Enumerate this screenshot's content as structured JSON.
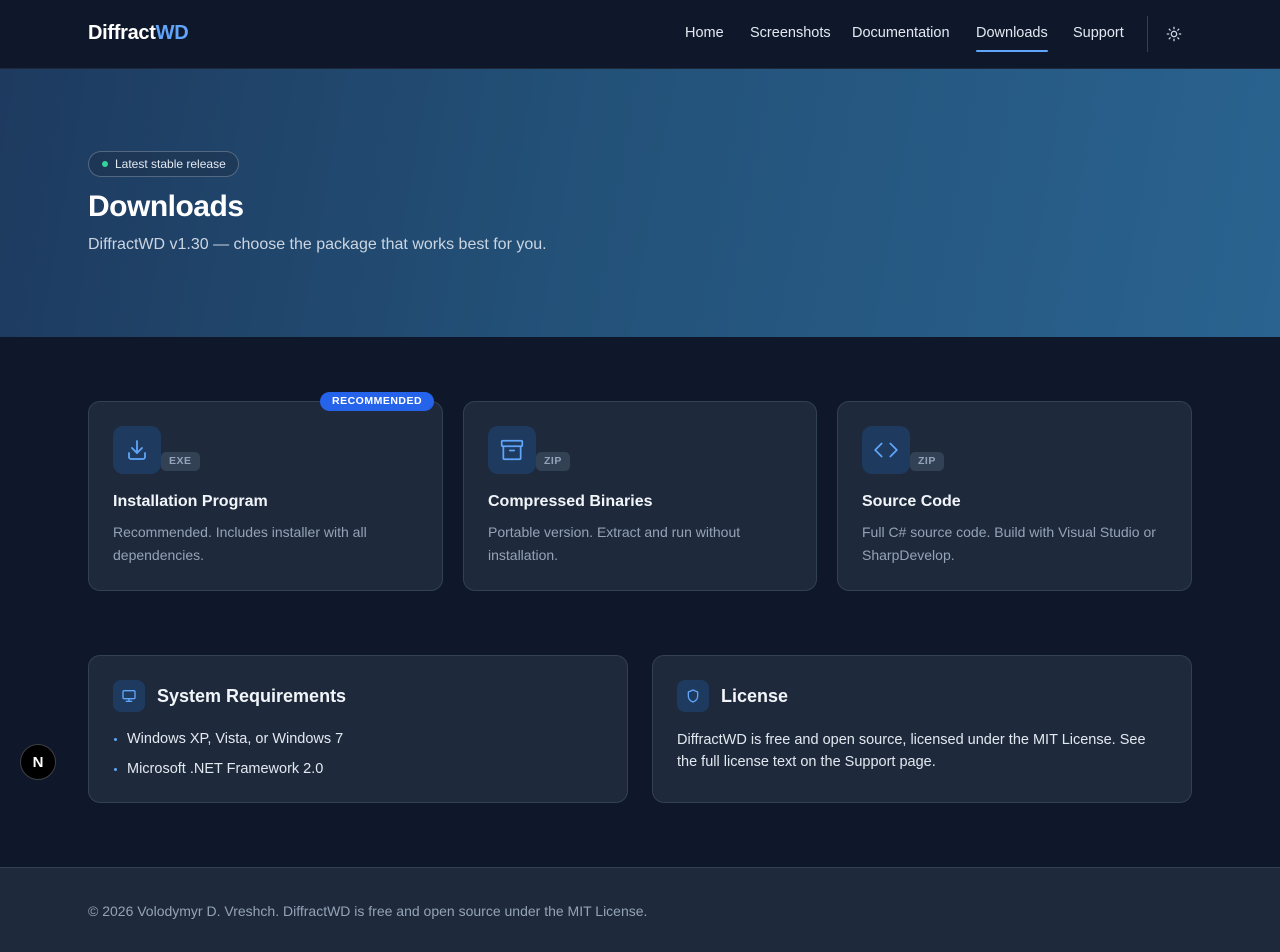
{
  "header": {
    "logo_main": "Diffract",
    "logo_accent": "WD",
    "nav": [
      {
        "label": "Home"
      },
      {
        "label": "Screenshots"
      },
      {
        "label": "Documentation"
      },
      {
        "label": "Downloads",
        "active": true
      },
      {
        "label": "Support"
      }
    ],
    "theme_icon": "sun-icon"
  },
  "hero": {
    "badge": "Latest stable release",
    "title": "Downloads",
    "subtitle": "DiffractWD v1.30 — choose the package that works best for you."
  },
  "downloads": [
    {
      "icon": "download-icon",
      "ext": "EXE",
      "title": "Installation Program",
      "description": "Recommended. Includes installer with all dependencies.",
      "tag": "RECOMMENDED"
    },
    {
      "icon": "archive-icon",
      "ext": "ZIP",
      "title": "Compressed Binaries",
      "description": "Portable version. Extract and run without installation."
    },
    {
      "icon": "code-icon",
      "ext": "ZIP",
      "title": "Source Code",
      "description": "Full C# source code. Build with Visual Studio or SharpDevelop."
    }
  ],
  "requirements": {
    "icon": "monitor-icon",
    "title": "System Requirements",
    "items": [
      "Windows XP, Vista, or Windows 7",
      "Microsoft .NET Framework 2.0"
    ]
  },
  "license": {
    "icon": "shield-icon",
    "title": "License",
    "text": "DiffractWD is free and open source, licensed under the MIT License. See the full license text on the Support page."
  },
  "footer": {
    "text": "© 2026 Volodymyr D. Vreshch. DiffractWD is free and open source under the MIT License."
  },
  "fab": {
    "label": "N"
  },
  "colors": {
    "background": "#0f172a",
    "card": "#1e293b",
    "accent": "#60a5fa",
    "recommended": "#2563eb",
    "status_dot": "#34d399"
  }
}
